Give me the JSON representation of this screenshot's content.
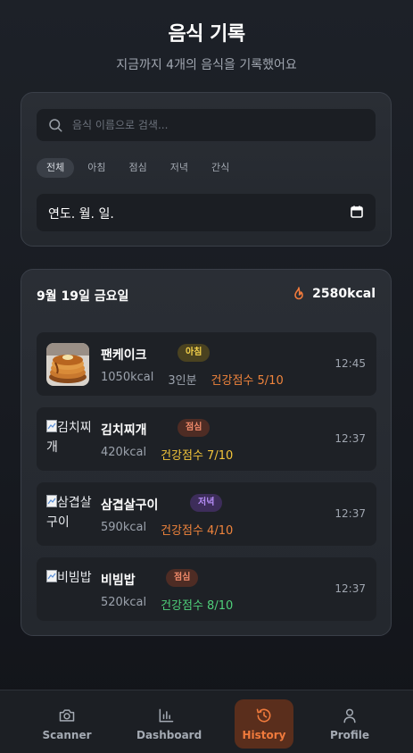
{
  "header": {
    "title": "음식 기록",
    "subtitle": "지금까지 4개의 음식을 기록했어요"
  },
  "filters": {
    "search_placeholder": "음식 이름으로 검색...",
    "chips": [
      "전체",
      "아침",
      "점심",
      "저녁",
      "간식"
    ],
    "active_chip": "전체",
    "date_placeholder": "연도. 월. 일."
  },
  "day": {
    "date_label": "9월 19일 금요일",
    "total_kcal": "2580kcal"
  },
  "meals": [
    {
      "name": "팬케이크",
      "meal_type": "아침",
      "kcal": "1050kcal",
      "servings": "3인분",
      "score": "건강점수 5/10",
      "score_color": "#f0843c",
      "time": "12:45",
      "image_alt": ""
    },
    {
      "name": "김치찌개",
      "meal_type": "점심",
      "kcal": "420kcal",
      "servings": "",
      "score": "건강점수 7/10",
      "score_color": "#f3c53a",
      "time": "12:37",
      "image_alt": "김치찌개"
    },
    {
      "name": "삼겹살구이",
      "meal_type": "저녁",
      "kcal": "590kcal",
      "servings": "",
      "score": "건강점수 4/10",
      "score_color": "#f0843c",
      "time": "12:37",
      "image_alt": "삼겹살구이"
    },
    {
      "name": "비빔밥",
      "meal_type": "점심",
      "kcal": "520kcal",
      "servings": "",
      "score": "건강점수 8/10",
      "score_color": "#4fd07a",
      "time": "12:37",
      "image_alt": "비빔밥"
    }
  ],
  "nav": {
    "items": [
      {
        "label": "Scanner",
        "icon": "camera-icon"
      },
      {
        "label": "Dashboard",
        "icon": "bar-chart-icon"
      },
      {
        "label": "History",
        "icon": "history-icon"
      },
      {
        "label": "Profile",
        "icon": "user-icon"
      }
    ],
    "active": "History"
  },
  "colors": {
    "accent": "#f07a3c",
    "breakfast_badge": "#f3d04a",
    "lunch_badge": "#f08a6a",
    "dinner_badge": "#b58cf5"
  }
}
